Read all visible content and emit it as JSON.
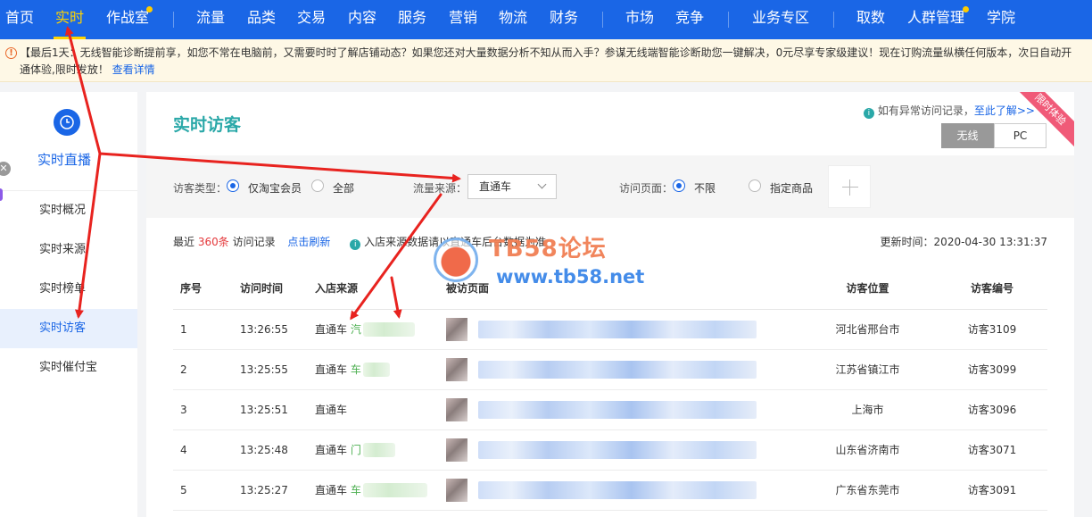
{
  "nav": {
    "items": [
      {
        "label": "首页",
        "active": false,
        "dot": false
      },
      {
        "label": "实时",
        "active": true,
        "dot": false
      },
      {
        "label": "作战室",
        "active": false,
        "dot": true
      },
      {
        "label": "流量",
        "active": false,
        "dot": false
      },
      {
        "label": "品类",
        "active": false,
        "dot": false
      },
      {
        "label": "交易",
        "active": false,
        "dot": false
      },
      {
        "label": "内容",
        "active": false,
        "dot": false
      },
      {
        "label": "服务",
        "active": false,
        "dot": false
      },
      {
        "label": "营销",
        "active": false,
        "dot": false
      },
      {
        "label": "物流",
        "active": false,
        "dot": false
      },
      {
        "label": "财务",
        "active": false,
        "dot": false
      },
      {
        "label": "市场",
        "active": false,
        "dot": false
      },
      {
        "label": "竞争",
        "active": false,
        "dot": false
      },
      {
        "label": "业务专区",
        "active": false,
        "dot": false
      },
      {
        "label": "取数",
        "active": false,
        "dot": false
      },
      {
        "label": "人群管理",
        "active": false,
        "dot": true
      },
      {
        "label": "学院",
        "active": false,
        "dot": false
      }
    ]
  },
  "notice": {
    "text": "【最后1天：无线智能诊断提前享，如您不常在电脑前，又需要时时了解店铺动态？如果您还对大量数据分析不知从而入手？参谋无线端智能诊断助您一键解决，0元尽享专家级建议！现在订购流量纵横任何版本，次日自动开通体验,限时发放！",
    "link": "查看详情"
  },
  "sidebar": {
    "title": "实时直播",
    "items": [
      {
        "label": "实时概况",
        "active": false
      },
      {
        "label": "实时来源",
        "active": false
      },
      {
        "label": "实时榜单",
        "active": false
      },
      {
        "label": "实时访客",
        "active": true
      },
      {
        "label": "实时催付宝",
        "active": false
      }
    ]
  },
  "main": {
    "title": "实时访客",
    "ribbon": "限时体验",
    "abnormal_text": "如有异常访问记录，",
    "abnormal_link": "至此了解>>",
    "device": {
      "wireless": "无线",
      "pc": "PC",
      "selected": "无线"
    },
    "filters": {
      "visitor_type_label": "访客类型：",
      "visitor_type_opt1": "仅淘宝会员",
      "visitor_type_opt2": "全部",
      "source_label": "流量来源：",
      "source_value": "直通车",
      "page_label": "访问页面：",
      "page_opt1": "不限",
      "page_opt2": "指定商品"
    },
    "stats": {
      "prefix": "最近",
      "count": "360条",
      "suffix": "访问记录",
      "refresh": "点击刷新",
      "tip": "入店来源数据请以直通车后台数据为准",
      "update_time": "更新时间：2020-04-30 13:31:37"
    },
    "table": {
      "headers": [
        "序号",
        "访问时间",
        "入店来源",
        "被访页面",
        "访客位置",
        "访客编号"
      ],
      "rows": [
        {
          "no": "1",
          "time": "13:26:55",
          "source": "直通车",
          "kw": "汽",
          "location": "河北省邢台市",
          "id": "访客3109"
        },
        {
          "no": "2",
          "time": "13:25:55",
          "source": "直通车",
          "kw": "车",
          "location": "江苏省镇江市",
          "id": "访客3099"
        },
        {
          "no": "3",
          "time": "13:25:51",
          "source": "直通车",
          "kw": "",
          "location": "上海市",
          "id": "访客3096"
        },
        {
          "no": "4",
          "time": "13:25:48",
          "source": "直通车",
          "kw": "门",
          "location": "山东省济南市",
          "id": "访客3071"
        },
        {
          "no": "5",
          "time": "13:25:27",
          "source": "直通车",
          "kw": "车",
          "location": "广东省东莞市",
          "id": "访客3091"
        }
      ]
    }
  },
  "watermark": {
    "title": "TB58论坛",
    "url": "www.tb58.net"
  },
  "colors": {
    "nav_bg": "#1a66e6",
    "nav_active": "#ffd400",
    "title_teal": "#2aa8a8",
    "count_red": "#e4393c",
    "arrow_red": "#e8231f"
  }
}
